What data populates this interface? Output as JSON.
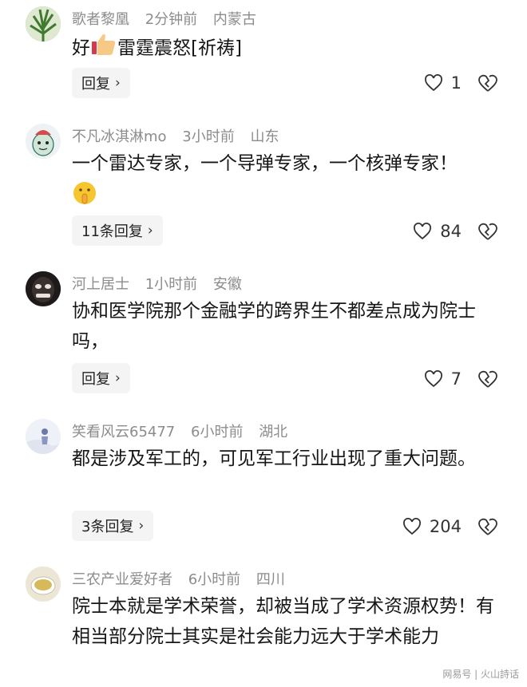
{
  "comments": [
    {
      "user": "歌者黎凰",
      "time": "2分钟前",
      "location": "内蒙古",
      "text_parts": [
        "好",
        "雷霆震怒[祈祷]"
      ],
      "reply_label": "回复",
      "likes": "1",
      "avatar_icon": "plant-avatar"
    },
    {
      "user": "不凡冰淇淋mo",
      "time": "3小时前",
      "location": "山东",
      "text": "一个雷达专家，一个导弹专家，一个核弹专家！",
      "reply_label": "11条回复",
      "likes": "84",
      "avatar_icon": "cartoon-avatar"
    },
    {
      "user": "河上居士",
      "time": "1小时前",
      "location": "安徽",
      "text": "协和医学院那个金融学的跨界生不都差点成为院士吗，",
      "reply_label": "回复",
      "likes": "7",
      "avatar_icon": "mask-avatar"
    },
    {
      "user": "笑看风云65477",
      "time": "6小时前",
      "location": "湖北",
      "text": "都是涉及军工的，可见军工行业出现了重大问题。",
      "reply_label": "3条回复",
      "likes": "204",
      "avatar_icon": "snow-avatar"
    },
    {
      "user": "三农产业爱好者",
      "time": "6小时前",
      "location": "四川",
      "text": "院士本就是学术荣誉，却被当成了学术资源权势！有相当部分院士其实是社会能力远大于学术能力",
      "avatar_icon": "tea-avatar"
    }
  ],
  "watermark": "网易号 | 火山詩话",
  "colors": {
    "meta": "#8c8c8c",
    "reply_bg": "#f4f4f4",
    "text": "#161616"
  }
}
